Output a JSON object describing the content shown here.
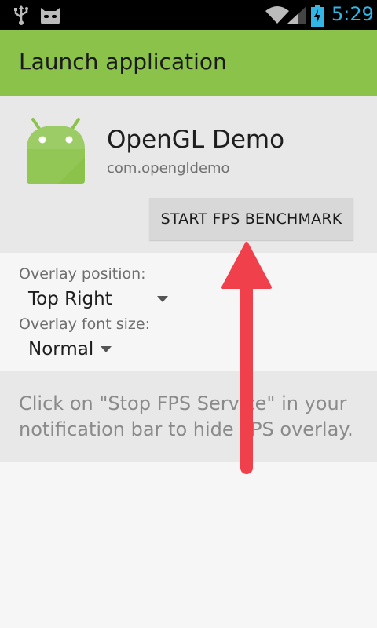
{
  "status_bar": {
    "time": "5:29",
    "icons": [
      "usb-icon",
      "cyanogen-mascot-icon",
      "wifi-icon",
      "signal-icon",
      "battery-charging-icon"
    ]
  },
  "action_bar": {
    "title": "Launch application"
  },
  "app": {
    "name": "OpenGL Demo",
    "package": "com.opengldemo",
    "icon": "android-robot-icon"
  },
  "benchmark_button": {
    "label": "START FPS BENCHMARK"
  },
  "overlay_position": {
    "label": "Overlay position:",
    "value": "Top Right"
  },
  "overlay_font_size": {
    "label": "Overlay font size:",
    "value": "Normal"
  },
  "info": {
    "message": "Click on \"Stop FPS Service\" in your notification bar to hide FPS overlay."
  },
  "colors": {
    "action_bar": "#8bc34a",
    "clock": "#33b5e5",
    "arrow": "#f0404c"
  }
}
